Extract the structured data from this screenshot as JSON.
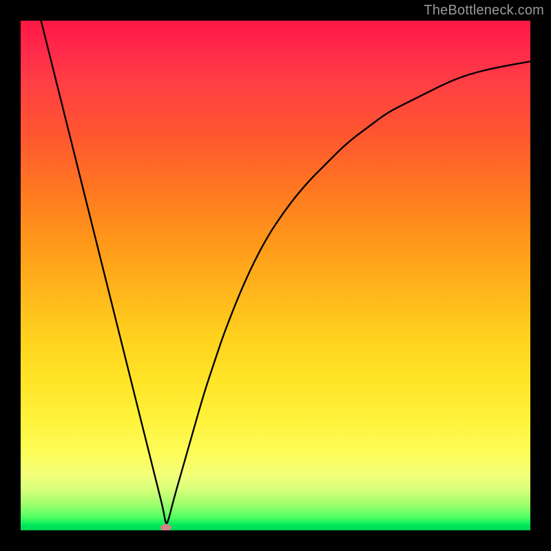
{
  "watermark": "TheBottleneck.com",
  "colors": {
    "frame": "#000000",
    "curve": "#000000",
    "marker": "#d88383"
  },
  "chart_data": {
    "type": "line",
    "title": "",
    "xlabel": "",
    "ylabel": "",
    "xlim": [
      0,
      100
    ],
    "ylim": [
      0,
      100
    ],
    "grid": false,
    "legend": false,
    "series": [
      {
        "name": "bottleneck-curve",
        "x": [
          4,
          6,
          8,
          10,
          12,
          14,
          16,
          18,
          20,
          22,
          24,
          26,
          27,
          28,
          28.5,
          29,
          30,
          32,
          34,
          36,
          38,
          40,
          44,
          48,
          52,
          56,
          60,
          64,
          68,
          72,
          76,
          80,
          84,
          88,
          92,
          96,
          100
        ],
        "y": [
          100,
          92,
          84,
          76,
          68,
          60,
          52,
          44,
          36,
          28,
          20,
          12,
          8,
          4,
          1,
          2,
          6,
          13,
          20,
          27,
          33,
          39,
          49,
          57,
          63,
          68,
          72,
          76,
          79,
          82,
          84,
          86,
          88,
          89.5,
          90.5,
          91.3,
          92
        ]
      }
    ],
    "marker": {
      "x": 28.5,
      "y": 0.5
    },
    "gradient_stops": [
      {
        "pos": 0.0,
        "color": "#ff1744"
      },
      {
        "pos": 0.22,
        "color": "#ff5530"
      },
      {
        "pos": 0.44,
        "color": "#ff9a1a"
      },
      {
        "pos": 0.7,
        "color": "#ffe326"
      },
      {
        "pos": 0.89,
        "color": "#f4ff78"
      },
      {
        "pos": 0.97,
        "color": "#4dff62"
      },
      {
        "pos": 1.0,
        "color": "#00d455"
      }
    ]
  }
}
